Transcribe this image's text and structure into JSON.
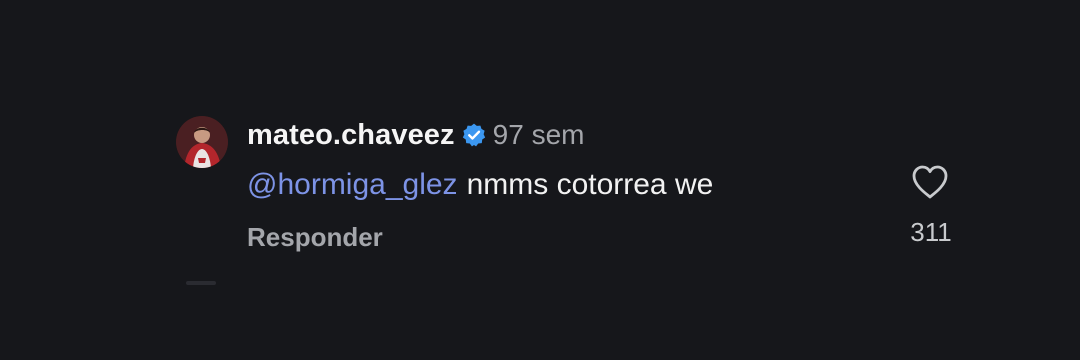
{
  "comment": {
    "username": "mateo.chaveez",
    "verified": true,
    "timestamp": "97 sem",
    "mention": "@hormiga_glez",
    "text": "nmms cotorrea we",
    "reply_label": "Responder",
    "like_count": "311"
  },
  "icons": {
    "verified": "verified-badge-icon",
    "like": "heart-icon"
  },
  "colors": {
    "background": "#16171b",
    "mention": "#7d93e6",
    "verified_badge": "#3b97f0",
    "secondary_text": "#a4a6ab"
  }
}
